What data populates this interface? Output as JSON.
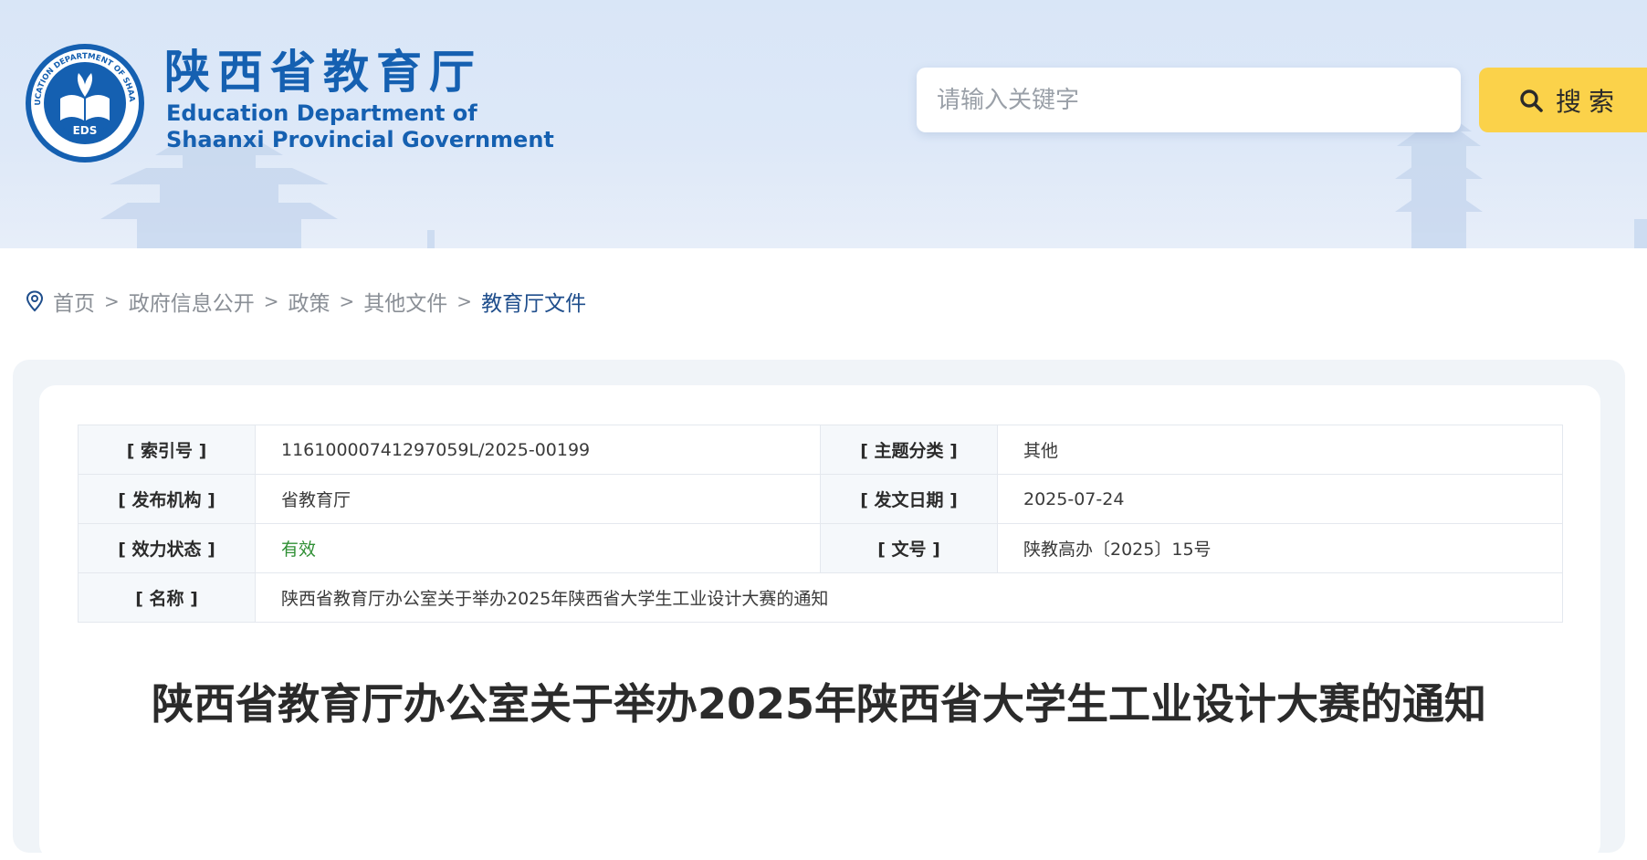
{
  "header": {
    "logo": {
      "ring_text": "EDUCATION DEPARTMENT OF SHAANXI",
      "center_text": "EDS",
      "bottom_text": "陕西省教育厅",
      "title_cn": "陕西省教育厅",
      "title_en_line1": "Education Department of",
      "title_en_line2": "Shaanxi Provincial Government"
    },
    "search": {
      "placeholder": "请输入关键字",
      "button_label": "搜索",
      "button_color": "#fbd24a"
    },
    "brand_color": "#1560b1"
  },
  "breadcrumb": {
    "icon": "location-pin-icon",
    "items": [
      "首页",
      "政府信息公开",
      "政策",
      "其他文件",
      "教育厅文件"
    ],
    "separator": ">"
  },
  "meta": {
    "index_no": {
      "label": "[ 索引号 ]",
      "value": "11610000741297059L/2025-00199"
    },
    "category": {
      "label": "[ 主题分类 ]",
      "value": "其他"
    },
    "publisher": {
      "label": "[ 发布机构 ]",
      "value": "省教育厅"
    },
    "date": {
      "label": "[ 发文日期 ]",
      "value": "2025-07-24"
    },
    "status": {
      "label": "[ 效力状态 ]",
      "value": "有效"
    },
    "doc_no": {
      "label": "[ 文号 ]",
      "value": "陕教高办〔2025〕15号"
    },
    "name": {
      "label": "[ 名称 ]",
      "value": "陕西省教育厅办公室关于举办2025年陕西省大学生工业设计大赛的通知"
    }
  },
  "document": {
    "title": "陕西省教育厅办公室关于举办2025年陕西省大学生工业设计大赛的通知"
  }
}
